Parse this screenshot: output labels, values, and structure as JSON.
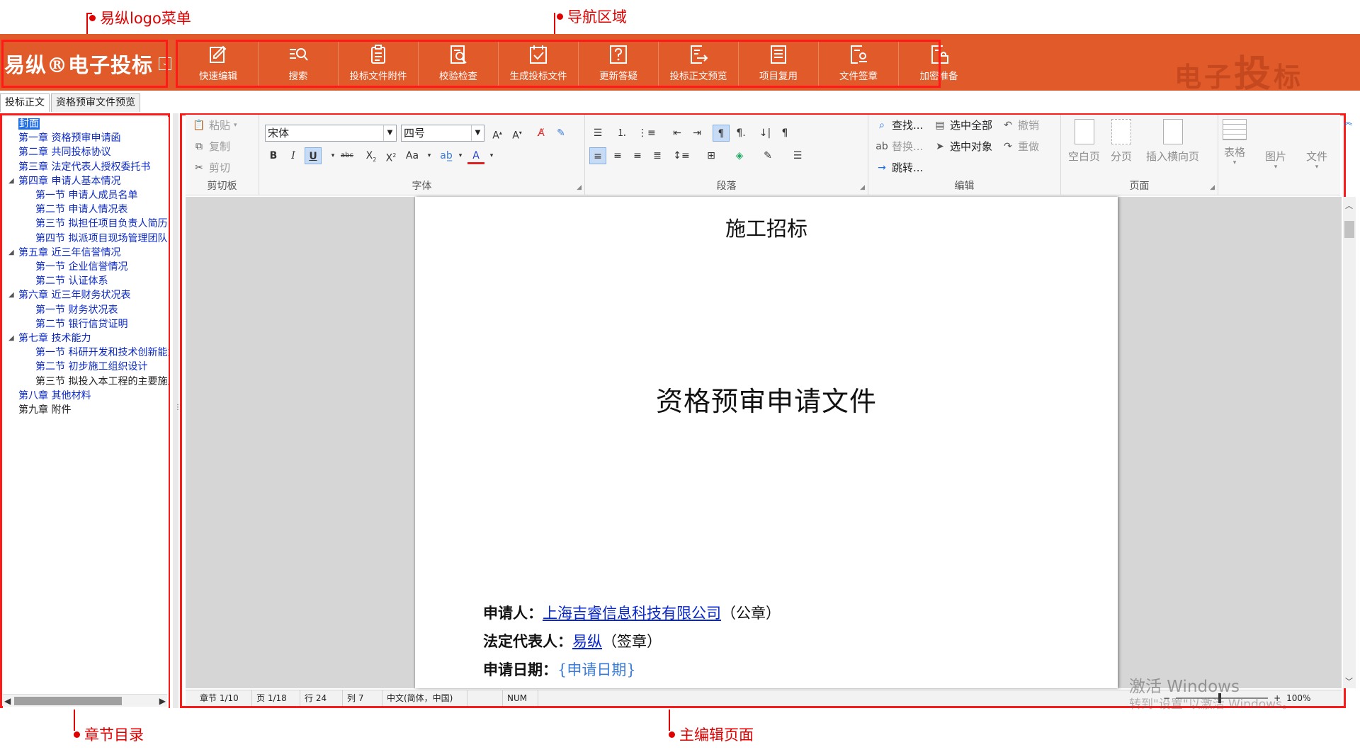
{
  "annotations": {
    "logo_menu": "易纵logo菜单",
    "nav_area": "导航区域",
    "toc": "章节目录",
    "editor": "主编辑页面"
  },
  "logo": {
    "text": "易纵®电子投标",
    "menu_glyph": "⌄"
  },
  "watermark": {
    "a": "电子",
    "b": "投",
    "c": "标"
  },
  "nav": {
    "items": [
      {
        "label": "快速编辑",
        "icon": "edit-icon"
      },
      {
        "label": "搜索",
        "icon": "search-list-icon"
      },
      {
        "label": "投标文件附件",
        "icon": "clipboard-icon"
      },
      {
        "label": "校验检查",
        "icon": "doc-search-icon"
      },
      {
        "label": "生成投标文件",
        "icon": "checkbox-doc-icon"
      },
      {
        "label": "更新答疑",
        "icon": "question-icon"
      },
      {
        "label": "投标正文预览",
        "icon": "export-doc-icon"
      },
      {
        "label": "项目复用",
        "icon": "doc-lines-icon"
      },
      {
        "label": "文件签章",
        "icon": "signature-icon"
      },
      {
        "label": "加密准备",
        "icon": "lock-doc-icon"
      }
    ]
  },
  "doc_tabs": [
    "投标正文",
    "资格预审文件预览"
  ],
  "toc": {
    "items": [
      {
        "label": "封面",
        "level": 1,
        "selected": true
      },
      {
        "label": "第一章 资格预审申请函",
        "level": 1
      },
      {
        "label": "第二章 共同投标协议",
        "level": 1
      },
      {
        "label": "第三章 法定代表人授权委托书",
        "level": 1
      },
      {
        "label": "第四章 申请人基本情况",
        "level": 1,
        "expanded": true
      },
      {
        "label": "第一节 申请人成员名单",
        "level": 2
      },
      {
        "label": "第二节 申请人情况表",
        "level": 2
      },
      {
        "label": "第三节 拟担任项目负责人简历",
        "level": 2
      },
      {
        "label": "第四节 拟派项目现场管理团队",
        "level": 2
      },
      {
        "label": "第五章 近三年信誉情况",
        "level": 1,
        "expanded": true
      },
      {
        "label": "第一节 企业信誉情况",
        "level": 2
      },
      {
        "label": "第二节 认证体系",
        "level": 2
      },
      {
        "label": "第六章 近三年财务状况表",
        "level": 1,
        "expanded": true
      },
      {
        "label": "第一节 财务状况表",
        "level": 2
      },
      {
        "label": "第二节 银行信贷证明",
        "level": 2
      },
      {
        "label": "第七章 技术能力",
        "level": 1,
        "expanded": true
      },
      {
        "label": "第一节 科研开发和技术创新能力",
        "level": 2
      },
      {
        "label": "第二节 初步施工组织设计",
        "level": 2
      },
      {
        "label": "第三节 拟投入本工程的主要施工",
        "level": 2,
        "black": true
      },
      {
        "label": "第八章 其他材料",
        "level": 1
      },
      {
        "label": "第九章 附件",
        "level": 1,
        "black": true
      }
    ]
  },
  "ribbon": {
    "clipboard": {
      "label": "剪切板",
      "paste": "粘贴",
      "copy": "复制",
      "cut": "剪切"
    },
    "font": {
      "label": "字体",
      "family": "宋体",
      "size": "四号"
    },
    "paragraph": {
      "label": "段落"
    },
    "edit": {
      "label": "编辑",
      "find": "查找...",
      "replace": "替换...",
      "goto": "跳转...",
      "select_all": "选中全部",
      "select_obj": "选中对象",
      "undo": "撤销",
      "redo": "重做"
    },
    "page": {
      "label": "页面",
      "blank": "空白页",
      "break": "分页",
      "landscape": "插入横向页"
    },
    "table": "表格",
    "image": "图片",
    "file": "文件"
  },
  "document": {
    "subtitle": "施工招标",
    "main_title": "资格预审申请文件",
    "applicant_label": "申请人：",
    "applicant_value": "上海吉睿信息科技有限公司",
    "applicant_suffix": "（公章）",
    "rep_label": "法定代表人：",
    "rep_value": "易纵",
    "rep_suffix": "（签章）",
    "date_label": "申请日期：",
    "date_value": "{申请日期}"
  },
  "status": {
    "chapter": "章节 1/10",
    "page": "页 1/18",
    "line": "行 24",
    "col": "列 7",
    "lang": "中文(简体，中国)",
    "num": "NUM",
    "zoom": "100%"
  },
  "os_watermark": {
    "line1": "激活 Windows",
    "line2": "转到\"设置\"以激活 Windows。"
  },
  "colors": {
    "brand": "#e05a2a",
    "annotation": "#e00000",
    "link": "#0a28c8"
  }
}
